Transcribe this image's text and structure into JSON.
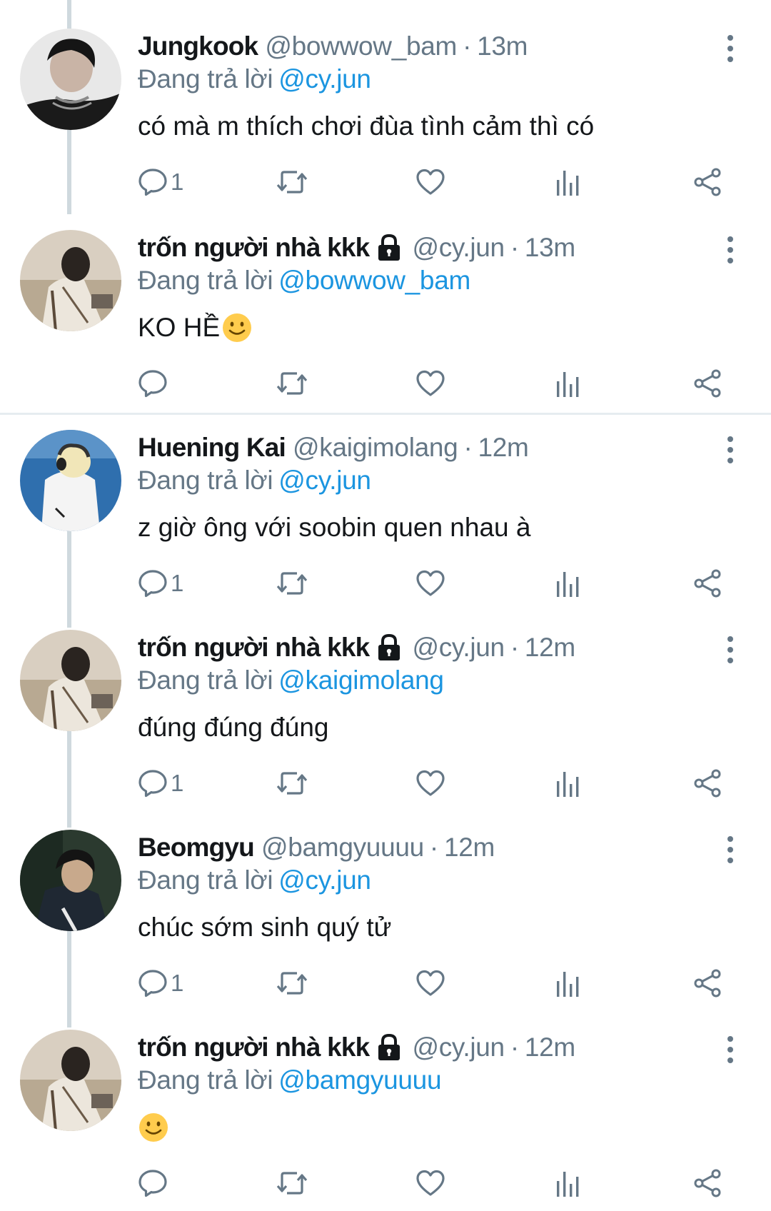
{
  "colors": {
    "text": "#14171a",
    "secondary": "#657786",
    "link": "#1b95e0",
    "icon": "#657786",
    "thread_line": "#cfd9de"
  },
  "icons": {
    "reply": "speech-bubble-icon",
    "retweet": "retweet-icon",
    "like": "heart-icon",
    "analytics": "bar-chart-icon",
    "share": "share-icon",
    "more": "vertical-ellipsis-icon",
    "protected": "lock-icon",
    "emoji": "slightly-smiling-face-icon"
  },
  "tweets": [
    {
      "name": "Jungkook",
      "handle": "@bowwow_bam",
      "dot": "·",
      "time": "13m",
      "replying_label": "Đang trả lời",
      "replying_to": "@cy.jun",
      "text": "có mà m thích chơi đùa tình cảm thì có",
      "reply_count": "1",
      "protected": false,
      "avatar": "dark-portrait"
    },
    {
      "name": "trốn người nhà kkk",
      "handle": "@cy.jun",
      "dot": "·",
      "time": "13m",
      "replying_label": "Đang trả lời",
      "replying_to": "@bowwow_bam",
      "text": "KO HỀ",
      "reply_count": "",
      "protected": true,
      "avatar": "beige-portrait"
    },
    {
      "name": "Huening Kai",
      "handle": "@kaigimolang",
      "dot": "·",
      "time": "12m",
      "replying_label": "Đang trả lời",
      "replying_to": "@cy.jun",
      "text": "z giờ ông với soobin quen nhau à",
      "reply_count": "1",
      "protected": false,
      "avatar": "blue-portrait"
    },
    {
      "name": "trốn người nhà kkk",
      "handle": "@cy.jun",
      "dot": "·",
      "time": "12m",
      "replying_label": "Đang trả lời",
      "replying_to": "@kaigimolang",
      "text": "đúng đúng đúng",
      "reply_count": "1",
      "protected": true,
      "avatar": "beige-portrait"
    },
    {
      "name": "Beomgyu",
      "handle": "@bamgyuuuu",
      "dot": "·",
      "time": "12m",
      "replying_label": "Đang trả lời",
      "replying_to": "@cy.jun",
      "text": "chúc sớm sinh quý tử",
      "reply_count": "1",
      "protected": false,
      "avatar": "dark-green-portrait"
    },
    {
      "name": "trốn người nhà kkk",
      "handle": "@cy.jun",
      "dot": "·",
      "time": "12m",
      "replying_label": "Đang trả lời",
      "replying_to": "@bamgyuuuu",
      "text": "",
      "reply_count": "",
      "protected": true,
      "avatar": "beige-portrait"
    }
  ]
}
